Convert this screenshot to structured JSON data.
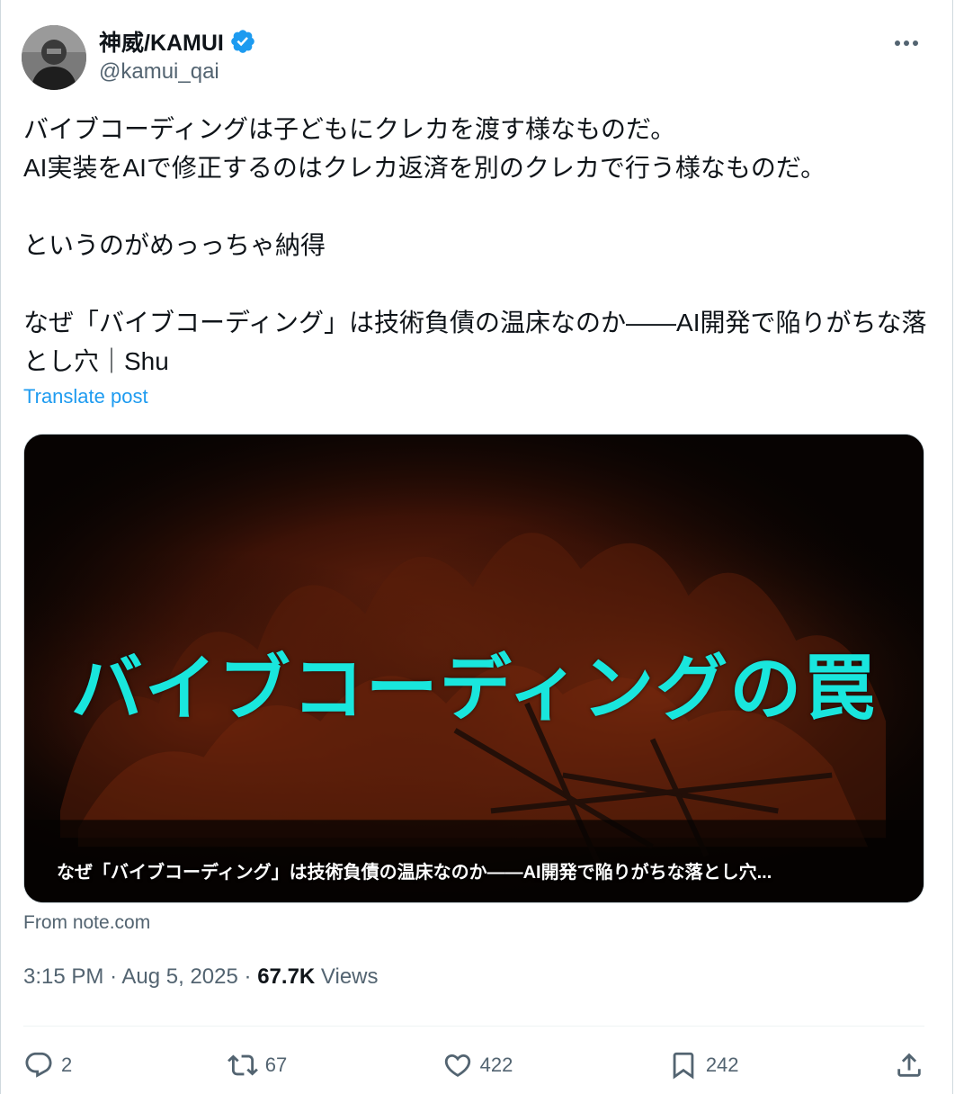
{
  "author": {
    "display_name": "神威/KAMUI",
    "handle": "@kamui_qai",
    "verified": true
  },
  "post": {
    "text": "バイブコーディングは子どもにクレカを渡す様なものだ。\nAI実装をAIで修正するのはクレカ返済を別のクレカで行う様なものだ。\n\nというのがめっっちゃ納得\n\nなぜ「バイブコーディング」は技術負債の温床なのか——AI開発で陥りがちな落とし穴｜Shu",
    "translate_label": "Translate post"
  },
  "card": {
    "headline": "バイブコーディングの罠",
    "caption": "なぜ「バイブコーディング」は技術負債の温床なのか——AI開発で陥りがちな落とし穴...",
    "source": "From note.com"
  },
  "meta": {
    "time": "3:15 PM",
    "date": "Aug 5, 2025",
    "views_count": "67.7K",
    "views_label": "Views"
  },
  "actions": {
    "replies": "2",
    "reposts": "67",
    "likes": "422",
    "bookmarks": "242"
  },
  "colors": {
    "link": "#1d9bf0",
    "verified": "#1d9bf0",
    "headline": "#19e6dd",
    "secondary_text": "#536471"
  },
  "icons": {
    "more": "more-horizontal-icon",
    "reply": "reply-icon",
    "repost": "repost-icon",
    "like": "heart-icon",
    "bookmark": "bookmark-icon",
    "share": "share-icon"
  }
}
